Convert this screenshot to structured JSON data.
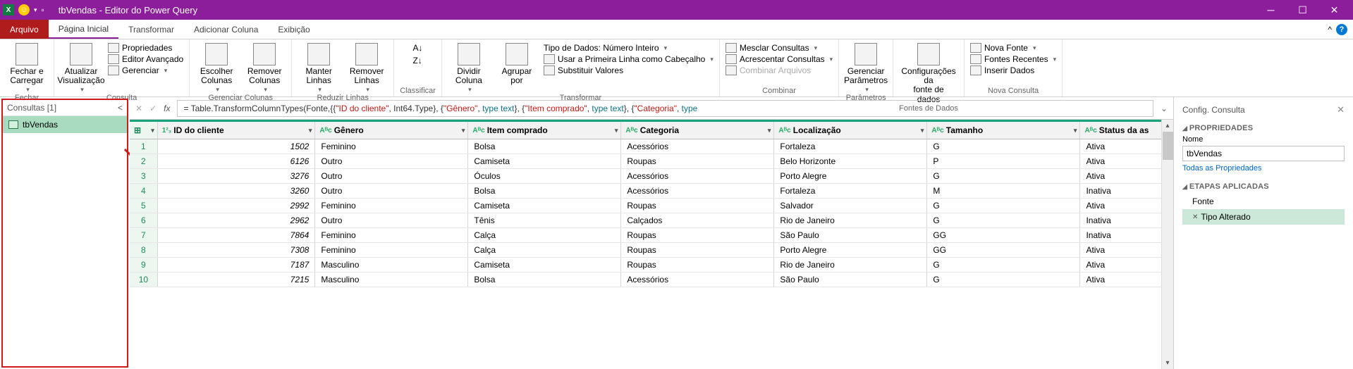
{
  "titlebar": {
    "title": "tbVendas - Editor do Power Query"
  },
  "tabs": {
    "file": "Arquivo",
    "items": [
      "Página Inicial",
      "Transformar",
      "Adicionar Coluna",
      "Exibição"
    ],
    "active": 0
  },
  "ribbon": {
    "fechar": {
      "label": "Fechar e\nCarregar",
      "group": "Fechar"
    },
    "consulta": {
      "atualizar": "Atualizar\nVisualização",
      "prop": "Propriedades",
      "adv": "Editor Avançado",
      "ger": "Gerenciar",
      "group": "Consulta"
    },
    "gercol": {
      "esc": "Escolher\nColunas",
      "rem": "Remover\nColunas",
      "group": "Gerenciar Colunas"
    },
    "redlin": {
      "mant": "Manter\nLinhas",
      "reml": "Remover\nLinhas",
      "group": "Reduzir Linhas"
    },
    "class": {
      "group": "Classificar"
    },
    "trans": {
      "div": "Dividir\nColuna",
      "agr": "Agrupar\npor",
      "tipo": "Tipo de Dados: Número Inteiro",
      "cab": "Usar a Primeira Linha como Cabeçalho",
      "sub": "Substituir Valores",
      "group": "Transformar"
    },
    "comb": {
      "mes": "Mesclar Consultas",
      "acr": "Acrescentar Consultas",
      "arq": "Combinar Arquivos",
      "group": "Combinar"
    },
    "param": {
      "ger": "Gerenciar\nParâmetros",
      "group": "Parâmetros"
    },
    "fontes": {
      "cfg": "Configurações da\nfonte de dados",
      "group": "Fontes de Dados"
    },
    "nova": {
      "nf": "Nova Fonte",
      "fr": "Fontes Recentes",
      "id": "Inserir Dados",
      "group": "Nova Consulta"
    }
  },
  "queries": {
    "header": "Consultas [1]",
    "item": "tbVendas"
  },
  "formula": "= Table.TransformColumnTypes(Fonte,{{\"ID do cliente\", Int64.Type}, {\"Gênero\", type text}, {\"Item comprado\", type text}, {\"Categoria\", type",
  "columns": [
    {
      "t": "1²₃",
      "n": "ID do cliente"
    },
    {
      "t": "Aᴮc",
      "n": "Gênero"
    },
    {
      "t": "Aᴮc",
      "n": "Item comprado"
    },
    {
      "t": "Aᴮc",
      "n": "Categoria"
    },
    {
      "t": "Aᴮc",
      "n": "Localização"
    },
    {
      "t": "Aᴮc",
      "n": "Tamanho"
    },
    {
      "t": "Aᴮc",
      "n": "Status da as"
    }
  ],
  "rows": [
    {
      "id": 1502,
      "gen": "Feminino",
      "item": "Bolsa",
      "cat": "Acessórios",
      "loc": "Fortaleza",
      "tam": "G",
      "st": "Ativa"
    },
    {
      "id": 6126,
      "gen": "Outro",
      "item": "Camiseta",
      "cat": "Roupas",
      "loc": "Belo Horizonte",
      "tam": "P",
      "st": "Ativa"
    },
    {
      "id": 3276,
      "gen": "Outro",
      "item": "Óculos",
      "cat": "Acessórios",
      "loc": "Porto Alegre",
      "tam": "G",
      "st": "Ativa"
    },
    {
      "id": 3260,
      "gen": "Outro",
      "item": "Bolsa",
      "cat": "Acessórios",
      "loc": "Fortaleza",
      "tam": "M",
      "st": "Inativa"
    },
    {
      "id": 2992,
      "gen": "Feminino",
      "item": "Camiseta",
      "cat": "Roupas",
      "loc": "Salvador",
      "tam": "G",
      "st": "Ativa"
    },
    {
      "id": 2962,
      "gen": "Outro",
      "item": "Tênis",
      "cat": "Calçados",
      "loc": "Rio de Janeiro",
      "tam": "G",
      "st": "Inativa"
    },
    {
      "id": 7864,
      "gen": "Feminino",
      "item": "Calça",
      "cat": "Roupas",
      "loc": "São Paulo",
      "tam": "GG",
      "st": "Inativa"
    },
    {
      "id": 7308,
      "gen": "Feminino",
      "item": "Calça",
      "cat": "Roupas",
      "loc": "Porto Alegre",
      "tam": "GG",
      "st": "Ativa"
    },
    {
      "id": 7187,
      "gen": "Masculino",
      "item": "Camiseta",
      "cat": "Roupas",
      "loc": "Rio de Janeiro",
      "tam": "G",
      "st": "Ativa"
    },
    {
      "id": 7215,
      "gen": "Masculino",
      "item": "Bolsa",
      "cat": "Acessórios",
      "loc": "São Paulo",
      "tam": "G",
      "st": "Ativa"
    }
  ],
  "settings": {
    "title": "Config. Consulta",
    "prop": "PROPRIEDADES",
    "nome": "Nome",
    "nomeval": "tbVendas",
    "all": "Todas as Propriedades",
    "etapas": "ETAPAS APLICADAS",
    "step1": "Fonte",
    "step2": "Tipo Alterado"
  }
}
